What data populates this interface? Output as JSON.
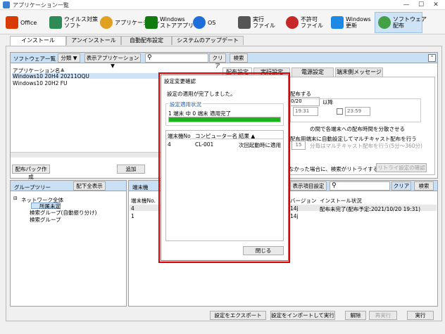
{
  "window": {
    "title": "アプリケーション一覧",
    "minimize": "—",
    "maximize": "☐",
    "close": "✕"
  },
  "toolbar": [
    {
      "label": "Office",
      "icon": "office-icon",
      "color": "#d83b01"
    },
    {
      "label": "ウイルス対策\nソフト",
      "icon": "antivirus-icon",
      "color": "#2e8b57"
    },
    {
      "label": "アプリケーション",
      "icon": "application-icon",
      "color": "#e0a020"
    },
    {
      "label": "Windows\nストアアプリ",
      "icon": "store-icon",
      "color": "#107c10"
    },
    {
      "label": "OS",
      "icon": "os-icon",
      "color": "#1e6fd9"
    },
    {
      "label": "実行\nファイル",
      "icon": "exe-icon",
      "color": "#555555"
    },
    {
      "label": "不許可\nファイル",
      "icon": "forbidden-icon",
      "color": "#c62828"
    },
    {
      "label": "Windows\n更新",
      "icon": "windows-update-icon",
      "color": "#1e88e5"
    },
    {
      "label": "ソフトウェア\n配布",
      "icon": "distribution-icon",
      "color": "#43a047"
    }
  ],
  "tabs": [
    "インストール",
    "アンインストール",
    "自動配布設定",
    "システムのアップデート"
  ],
  "software": {
    "title": "ソフトウェア一覧",
    "category": "分類 ▼",
    "display_app": "表示アプリケーション ▼",
    "clear": "クリア",
    "search": "検索",
    "column": "アプリケーション名",
    "items": [
      "Windows10 20H4 20211OQU",
      "Windows10 20H2 FU"
    ],
    "create_pack": "配布パック作成",
    "add": "追加"
  },
  "settings": {
    "tabs": [
      "配布設定",
      "実行設定",
      "電源設定",
      "端末側メッセージ"
    ],
    "distribute": "配布する",
    "date_from": "0/20",
    "time_from": "19:31",
    "after": "以降",
    "time_to": "23:59",
    "spread": "の間で各端末への配布時間を分散させる",
    "multicast": "配布用端末に自動設定してマルチキャスト配布を行う",
    "multicast_num": "15",
    "multicast_sub": "分毎はマルチキャスト配布を行う(5分〜360分)",
    "retry": "なかった場合に、検索がリトライする",
    "retry_confirm": "リトライ設定の確認"
  },
  "grouptree": {
    "title": "グループツリー",
    "expand_all": "配下全表示",
    "items": [
      "ネットワーク全体",
      "所属未定",
      "検索グループ(自動振り分け)",
      "検索グループ"
    ]
  },
  "terminal": {
    "title": "端末機",
    "display_items": "表示項目設定",
    "clear": "クリア",
    "search": "検索",
    "columns": [
      "端末機No.",
      "バージョン",
      "インストール状況"
    ],
    "rows": [
      {
        "no": "4",
        "version": "14j",
        "status": "配布未完了(配布予定:2021/10/20 19:31)"
      },
      {
        "no": "1",
        "version": "14j",
        "status": ""
      }
    ]
  },
  "bottom_buttons": [
    "設定をエクスポート",
    "設定をインポートして実行",
    "解除",
    "再実行",
    "実行"
  ],
  "dialog": {
    "title": "設定変更確認",
    "message": "設定の適用が完了しました。",
    "group": "設定適用状況",
    "status": "1 端末 中 0 端末 適用完了",
    "progress_fraction": 1.0,
    "columns": [
      "端末機No",
      "コンピューター名",
      "結果 ▲"
    ],
    "rows": [
      {
        "no": "4",
        "name": "CL-001",
        "result": "次回起動時に適用"
      }
    ],
    "close": "閉じる"
  },
  "colors": {
    "accent": "#c9dff3",
    "progress": "#1db51d",
    "highlight": "#e00000",
    "selected": "#cfe3f7"
  }
}
